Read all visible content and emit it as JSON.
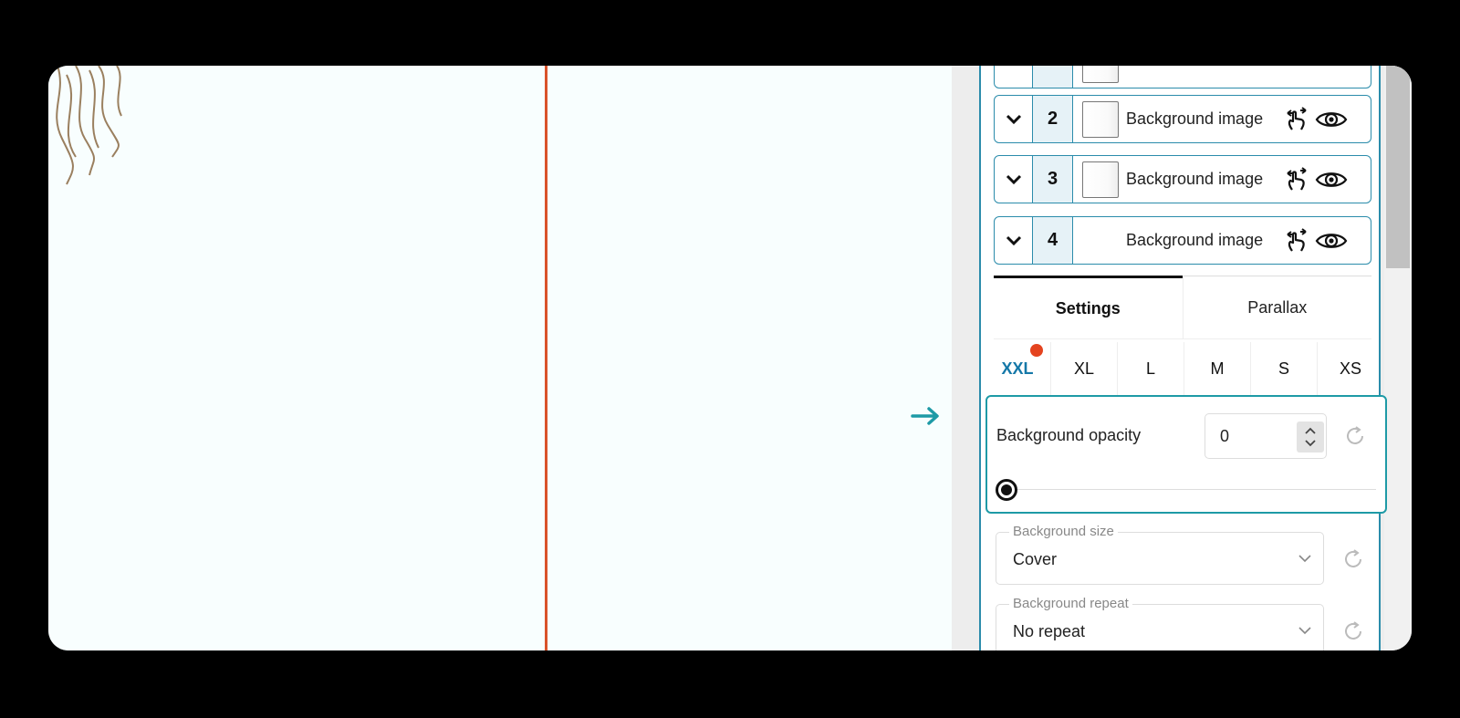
{
  "layers": [
    {
      "number": "",
      "label": ""
    },
    {
      "number": "2",
      "label": "Background image"
    },
    {
      "number": "3",
      "label": "Background image"
    },
    {
      "number": "4",
      "label": "Background image"
    }
  ],
  "tabs": {
    "settings": "Settings",
    "parallax": "Parallax"
  },
  "breakpoints": [
    "XXL",
    "XL",
    "L",
    "M",
    "S",
    "XS"
  ],
  "active_breakpoint": "XXL",
  "opacity": {
    "label": "Background opacity",
    "value": "0",
    "slider_fraction": 0
  },
  "background_size": {
    "legend": "Background size",
    "value": "Cover"
  },
  "background_repeat": {
    "legend": "Background repeat",
    "value": "No repeat"
  },
  "colors": {
    "accent": "#2b8cab",
    "highlight": "#1e9aa6",
    "guide_line": "#d9532b",
    "indicator_dot": "#e4431f",
    "active_breakpoint": "#1578a8"
  },
  "icons": {
    "layer_toggle": "chevron-down-icon",
    "interaction": "pointer-hand-icon",
    "visibility": "eye-icon",
    "reset": "reset-icon",
    "pointer": "arrow-right-icon"
  }
}
